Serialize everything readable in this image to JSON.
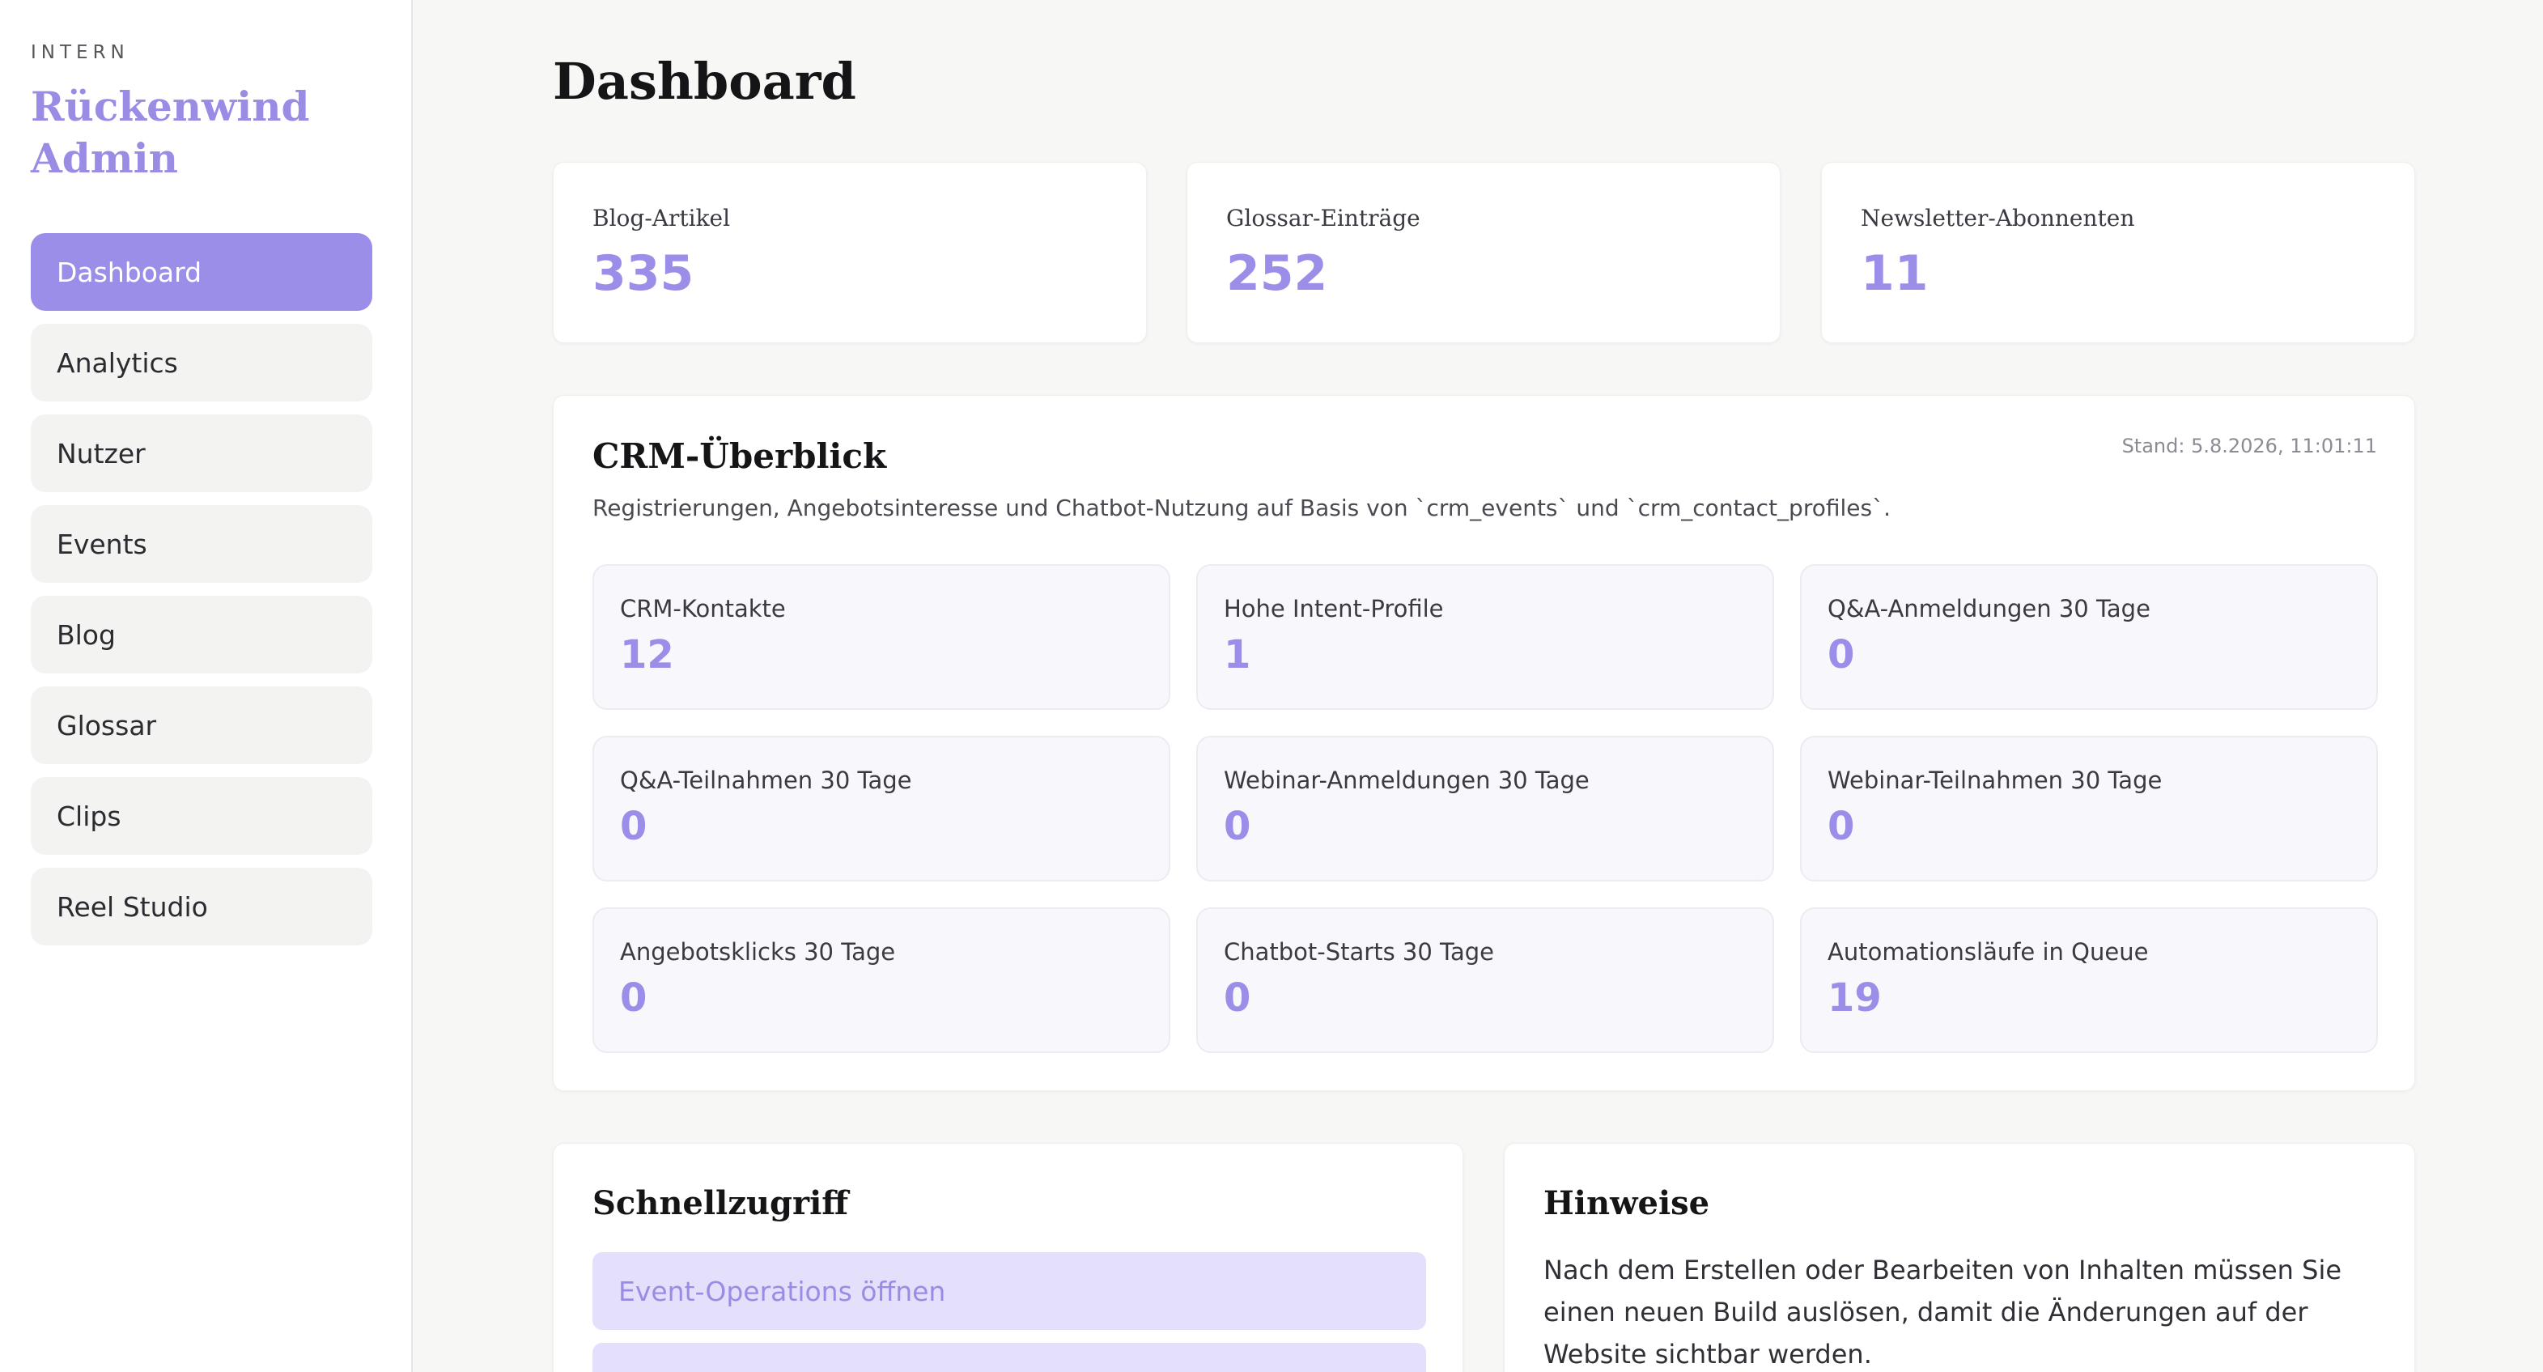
{
  "sidebar": {
    "kicker": "INTERN",
    "title": "Rückenwind Admin",
    "items": [
      {
        "label": "Dashboard",
        "active": true
      },
      {
        "label": "Analytics"
      },
      {
        "label": "Nutzer"
      },
      {
        "label": "Events"
      },
      {
        "label": "Blog"
      },
      {
        "label": "Glossar"
      },
      {
        "label": "Clips"
      },
      {
        "label": "Reel Studio"
      }
    ]
  },
  "page": {
    "title": "Dashboard"
  },
  "stats": [
    {
      "label": "Blog-Artikel",
      "value": "335"
    },
    {
      "label": "Glossar-Einträge",
      "value": "252"
    },
    {
      "label": "Newsletter-Abonnenten",
      "value": "11"
    }
  ],
  "crm": {
    "title": "CRM-Überblick",
    "stand": "Stand: 5.8.2026, 11:01:11",
    "description": "Registrierungen, Angebotsinteresse und Chatbot-Nutzung auf Basis von `crm_events` und `crm_contact_profiles`.",
    "metrics": [
      {
        "label": "CRM-Kontakte",
        "value": "12"
      },
      {
        "label": "Hohe Intent-Profile",
        "value": "1"
      },
      {
        "label": "Q&A-Anmeldungen 30 Tage",
        "value": "0"
      },
      {
        "label": "Q&A-Teilnahmen 30 Tage",
        "value": "0"
      },
      {
        "label": "Webinar-Anmeldungen 30 Tage",
        "value": "0"
      },
      {
        "label": "Webinar-Teilnahmen 30 Tage",
        "value": "0"
      },
      {
        "label": "Angebotsklicks 30 Tage",
        "value": "0"
      },
      {
        "label": "Chatbot-Starts 30 Tage",
        "value": "0"
      },
      {
        "label": "Automationsläufe in Queue",
        "value": "19"
      }
    ]
  },
  "quick": {
    "title": "Schnellzugriff",
    "buttons": [
      {
        "label": "Event-Operations öffnen"
      },
      {
        "label": ""
      }
    ]
  },
  "hints": {
    "title": "Hinweise",
    "text": "Nach dem Erstellen oder Bearbeiten von Inhalten müssen Sie einen neuen Build auslösen, damit die Änderungen auf der Website sichtbar werden."
  },
  "colors": {
    "accent": "#9b8ee8",
    "accent_light": "#e4dffb",
    "background": "#f7f7f6"
  }
}
